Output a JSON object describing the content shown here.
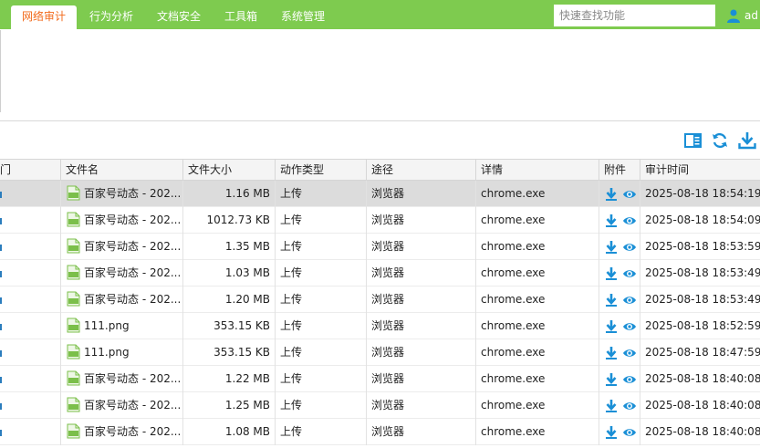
{
  "nav": {
    "tabs": [
      "网络审计",
      "行为分析",
      "文档安全",
      "工具箱",
      "系统管理"
    ],
    "active_index": 0,
    "search_placeholder": "快速查找功能",
    "user_label": "ad"
  },
  "colors": {
    "nav_bg": "#7ecb4f",
    "active_tab_text": "#f26a1b",
    "accent_blue": "#1a8fd6"
  },
  "toolbar": {
    "icons": [
      "columns-icon",
      "refresh-icon",
      "download-icon"
    ]
  },
  "table": {
    "columns": [
      "部门",
      "文件名",
      "文件大小",
      "动作类型",
      "途径",
      "详情",
      "附件",
      "审计时间"
    ],
    "selected_row": 0,
    "rows": [
      {
        "file": "百家号动态 - 202...",
        "size": "1.16 MB",
        "action": "上传",
        "via": "浏览器",
        "detail": "chrome.exe",
        "time": "2025-08-18 18:54:19"
      },
      {
        "file": "百家号动态 - 202...",
        "size": "1012.73 KB",
        "action": "上传",
        "via": "浏览器",
        "detail": "chrome.exe",
        "time": "2025-08-18 18:54:09"
      },
      {
        "file": "百家号动态 - 202...",
        "size": "1.35 MB",
        "action": "上传",
        "via": "浏览器",
        "detail": "chrome.exe",
        "time": "2025-08-18 18:53:59"
      },
      {
        "file": "百家号动态 - 202...",
        "size": "1.03 MB",
        "action": "上传",
        "via": "浏览器",
        "detail": "chrome.exe",
        "time": "2025-08-18 18:53:49"
      },
      {
        "file": "百家号动态 - 202...",
        "size": "1.20 MB",
        "action": "上传",
        "via": "浏览器",
        "detail": "chrome.exe",
        "time": "2025-08-18 18:53:49"
      },
      {
        "file": "111.png",
        "size": "353.15 KB",
        "action": "上传",
        "via": "浏览器",
        "detail": "chrome.exe",
        "time": "2025-08-18 18:52:59"
      },
      {
        "file": "111.png",
        "size": "353.15 KB",
        "action": "上传",
        "via": "浏览器",
        "detail": "chrome.exe",
        "time": "2025-08-18 18:47:59"
      },
      {
        "file": "百家号动态 - 202...",
        "size": "1.22 MB",
        "action": "上传",
        "via": "浏览器",
        "detail": "chrome.exe",
        "time": "2025-08-18 18:40:08"
      },
      {
        "file": "百家号动态 - 202...",
        "size": "1.25 MB",
        "action": "上传",
        "via": "浏览器",
        "detail": "chrome.exe",
        "time": "2025-08-18 18:40:08"
      },
      {
        "file": "百家号动态 - 202...",
        "size": "1.08 MB",
        "action": "上传",
        "via": "浏览器",
        "detail": "chrome.exe",
        "time": "2025-08-18 18:40:08"
      }
    ]
  }
}
